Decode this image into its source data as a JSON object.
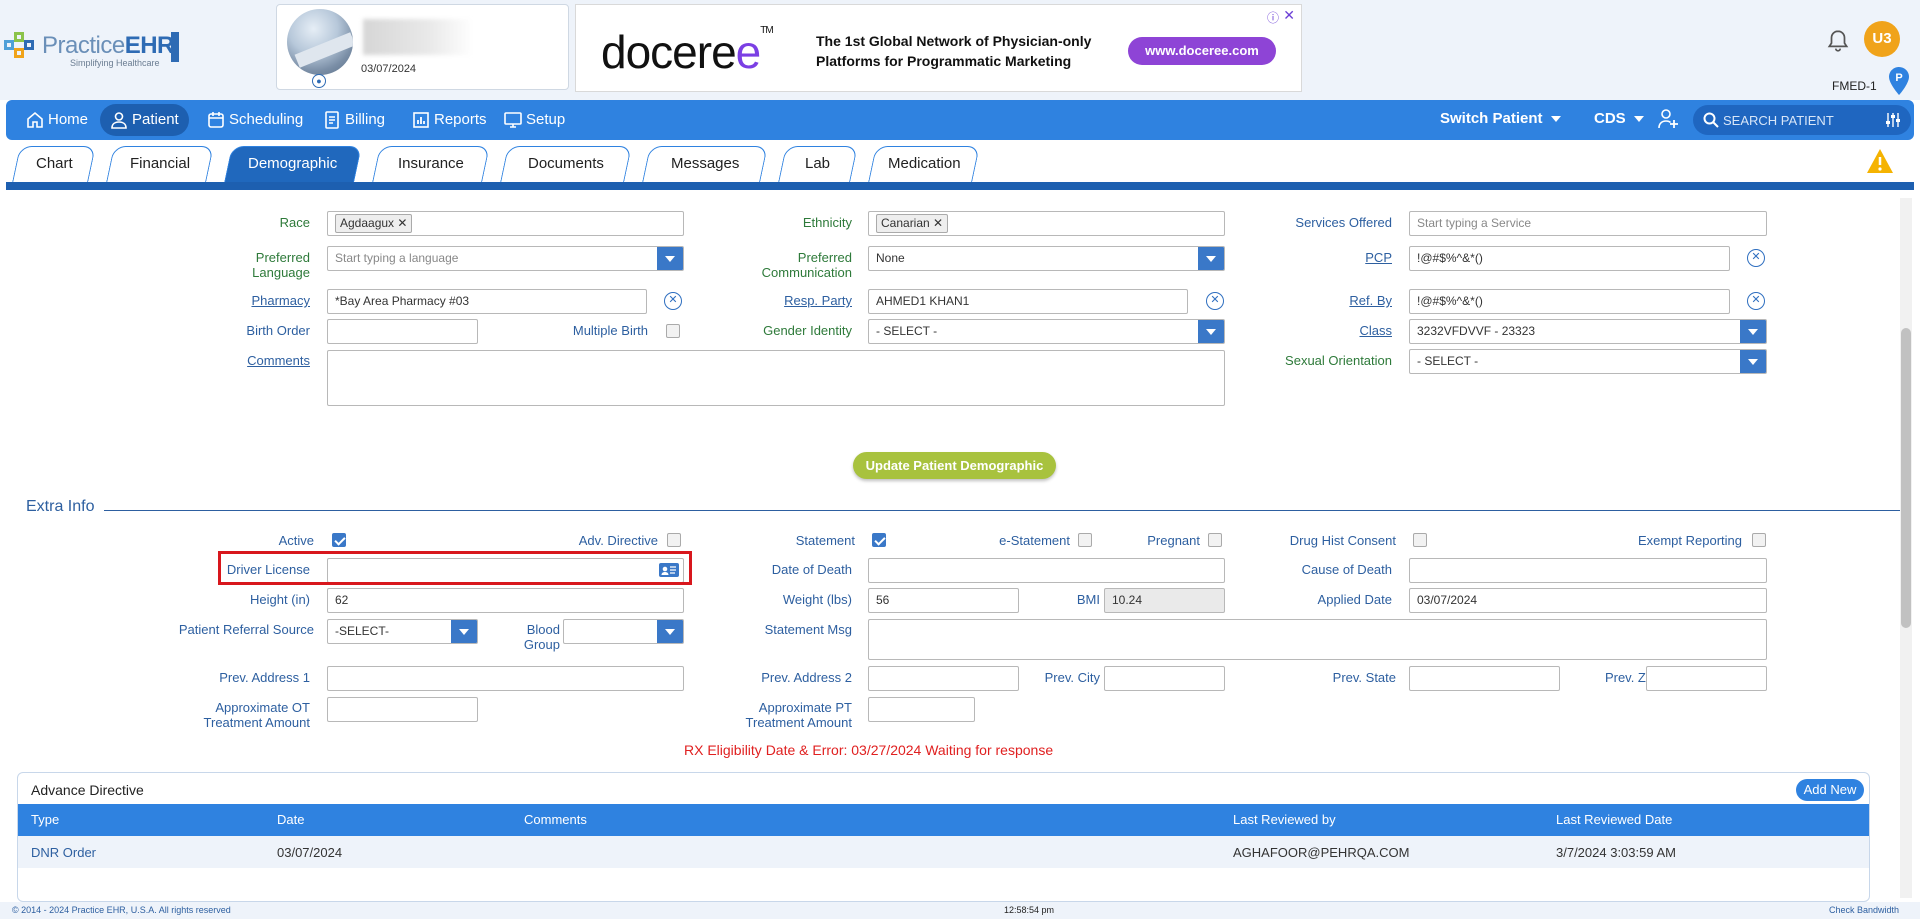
{
  "header": {
    "logo": {
      "brand_light": "Practice",
      "brand_bold": "EHR",
      "tagline": "Simplifying Healthcare"
    },
    "patient_card": {
      "date": "03/07/2024"
    },
    "ad": {
      "logo_text": "doceree",
      "tm": "TM",
      "headline_line1": "The 1st Global Network of Physician-only",
      "headline_line2": "Platforms for Programmatic Marketing",
      "button": "www.doceree.com"
    },
    "user_initials": "U3",
    "location": "FMED-1",
    "pin_letter": "P"
  },
  "nav": {
    "items": [
      {
        "label": "Home",
        "icon": "home-icon"
      },
      {
        "label": "Patient",
        "icon": "user-icon"
      },
      {
        "label": "Scheduling",
        "icon": "calendar-icon"
      },
      {
        "label": "Billing",
        "icon": "invoice-icon"
      },
      {
        "label": "Reports",
        "icon": "chart-icon"
      },
      {
        "label": "Setup",
        "icon": "monitor-gear-icon"
      }
    ],
    "switch_patient": "Switch Patient",
    "cds": "CDS",
    "search_placeholder": "SEARCH PATIENT"
  },
  "tabs": [
    "Chart",
    "Financial",
    "Demographic",
    "Insurance",
    "Documents",
    "Messages",
    "Lab",
    "Medication"
  ],
  "active_tab": "Demographic",
  "demographic": {
    "race_label": "Race",
    "race_value": "Agdaagux",
    "ethnicity_label": "Ethnicity",
    "ethnicity_value": "Canarian",
    "services_label": "Services Offered",
    "services_placeholder": "Start typing a Service",
    "pref_lang_label_1": "Preferred",
    "pref_lang_label_2": "Language",
    "pref_lang_placeholder": "Start typing a language",
    "pref_comm_label_1": "Preferred",
    "pref_comm_label_2": "Communication",
    "pref_comm_value": "None",
    "pcp_label": "PCP",
    "pcp_value": "!@#$%^&*()",
    "pharmacy_label": "Pharmacy",
    "pharmacy_value": "*Bay Area Pharmacy #03",
    "resp_label": "Resp. Party",
    "resp_value": "AHMED1 KHAN1",
    "refby_label": "Ref. By",
    "refby_value": "!@#$%^&*()",
    "birth_order_label": "Birth Order",
    "multiple_birth_label": "Multiple Birth",
    "gender_label": "Gender Identity",
    "gender_value": "- SELECT -",
    "class_label": "Class",
    "class_value": "3232VFDVVF - 23323",
    "comments_label": "Comments",
    "sexual_label": "Sexual Orientation",
    "sexual_value": "- SELECT -",
    "update_button": "Update Patient Demographic"
  },
  "extra": {
    "title": "Extra Info",
    "active_label": "Active",
    "adv_directive_label": "Adv. Directive",
    "statement_label": "Statement",
    "estatement_label": "e-Statement",
    "pregnant_label": "Pregnant",
    "drug_hist_label": "Drug Hist Consent",
    "exempt_label": "Exempt Reporting",
    "driver_license_label": "Driver License",
    "date_of_death_label": "Date of Death",
    "cause_of_death_label": "Cause of Death",
    "height_label": "Height (in)",
    "height_value": "62",
    "weight_label": "Weight (lbs)",
    "weight_value": "56",
    "bmi_label": "BMI",
    "bmi_value": "10.24",
    "applied_date_label": "Applied Date",
    "applied_date_value": "03/07/2024",
    "referral_label": "Patient Referral Source",
    "referral_value": "-SELECT-",
    "blood_label_1": "Blood",
    "blood_label_2": "Group",
    "statement_msg_label": "Statement Msg",
    "prev_addr1_label": "Prev. Address 1",
    "prev_addr2_label": "Prev. Address 2",
    "prev_city_label": "Prev. City",
    "prev_state_label": "Prev. State",
    "prev_zip_label": "Prev. Zip",
    "ot_label_1": "Approximate OT",
    "ot_label_2": "Treatment Amount",
    "pt_label_1": "Approximate PT",
    "pt_label_2": "Treatment Amount",
    "rx_message": "RX Eligibility Date & Error: 03/27/2024 Waiting for response",
    "checks": {
      "active": true,
      "adv_directive": false,
      "statement": true,
      "estatement": false,
      "pregnant": false,
      "drug_hist": false,
      "exempt": false,
      "multiple_birth": false
    }
  },
  "advance_directive": {
    "title": "Advance Directive",
    "add_button": "Add New",
    "columns": [
      "Type",
      "Date",
      "Comments",
      "Last Reviewed by",
      "Last Reviewed Date"
    ],
    "rows": [
      {
        "type": "DNR Order",
        "date": "03/07/2024",
        "comments": "",
        "reviewed_by": "AGHAFOOR@PEHRQA.COM",
        "reviewed_date": "3/7/2024 3:03:59 AM"
      }
    ]
  },
  "footer": {
    "copyright": "© 2014 - 2024 Practice EHR, U.S.A. All rights reserved",
    "time": "12:58:54 pm",
    "bandwidth": "Check Bandwidth"
  }
}
